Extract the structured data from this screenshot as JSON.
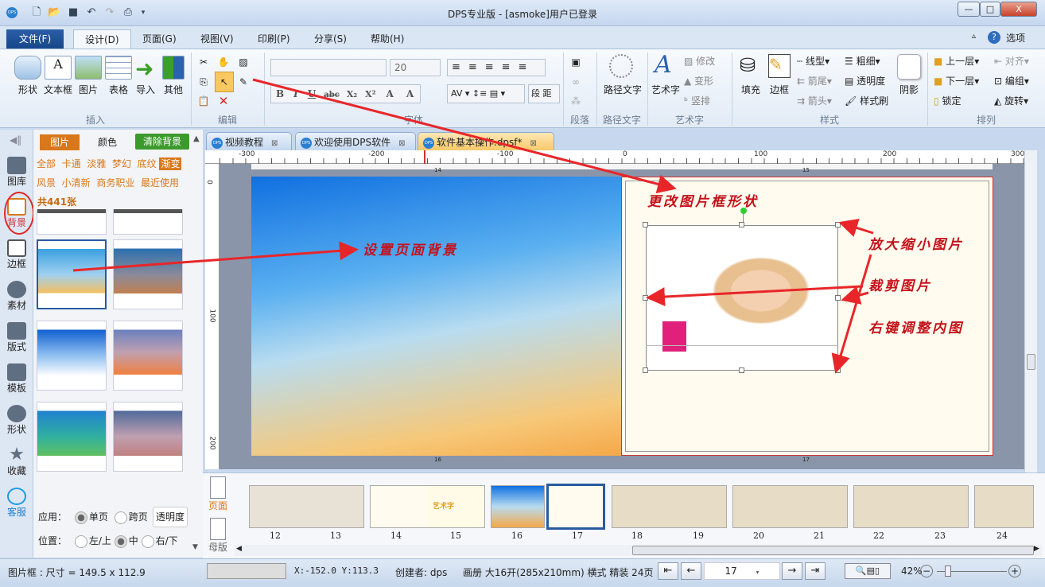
{
  "window": {
    "title": "DPS专业版 - [asmoke]用户已登录",
    "min": "—",
    "max": "□",
    "close": "X"
  },
  "menu": {
    "tabs": [
      "文件(F)",
      "设计(D)",
      "页面(G)",
      "视图(V)",
      "印刷(P)",
      "分享(S)",
      "帮助(H)"
    ],
    "active": "设计(D)",
    "options": "选项"
  },
  "ribbon": {
    "insert": {
      "label": "插入",
      "items": [
        "形状",
        "文本框",
        "图片",
        "表格",
        "导入",
        "其他"
      ]
    },
    "edit": {
      "label": "编辑"
    },
    "font": {
      "label": "字体",
      "font_name": "",
      "font_size": "20",
      "buttons": [
        "B",
        "I",
        "U",
        "abc",
        "X₂",
        "X²",
        "A",
        "A"
      ]
    },
    "paragraph": {
      "label": "段落",
      "buttons": [
        "段",
        "距"
      ]
    },
    "pathtext": {
      "label": "路径文字",
      "button": "路径文字"
    },
    "arttext": {
      "label": "艺术字",
      "button": "艺术字",
      "modify": "修改",
      "transform": "变形",
      "vertical": "竖排"
    },
    "style": {
      "label": "样式",
      "fill": "填充",
      "border": "边框",
      "linetype": "线型",
      "thickness": "粗细",
      "arrow_tail": "箭尾",
      "transparency": "透明度",
      "arrow_head": "箭头",
      "format_painter": "样式刷",
      "shadow": "阴影"
    },
    "arrange": {
      "label": "排列",
      "up": "上一层",
      "align": "对齐",
      "down": "下一层",
      "group": "编组",
      "lock": "锁定",
      "rotate": "旋转"
    }
  },
  "sidebar": {
    "items": [
      "图库",
      "背景",
      "边框",
      "素材",
      "版式",
      "模板",
      "形状",
      "收藏",
      "客服"
    ],
    "active": "背景"
  },
  "panel": {
    "tabs": [
      "图片",
      "颜色"
    ],
    "clear": "清除背景",
    "categories": [
      "全部",
      "卡通",
      "淡雅",
      "梦幻",
      "底纹",
      "渐变",
      "风景",
      "小清新",
      "商务职业",
      "最近使用"
    ],
    "active_category": "渐变",
    "count": "共441张",
    "apply_label": "应用：",
    "apply_options": [
      "单页",
      "跨页"
    ],
    "apply_selected": "单页",
    "transparency": "透明度",
    "position_label": "位置：",
    "position_options": [
      "左/上",
      "中",
      "右/下"
    ],
    "position_selected": "中"
  },
  "doc_tabs": [
    {
      "label": "视频教程"
    },
    {
      "label": "欢迎使用DPS软件"
    },
    {
      "label": "软件基本操作.dpsf*",
      "active": true
    }
  ],
  "ruler": {
    "top": [
      "-300",
      "-200",
      "-100",
      "0",
      "100",
      "200",
      "300"
    ],
    "left": [
      "0",
      "100",
      "200"
    ]
  },
  "canvas": {
    "page_numbers": [
      "14",
      "15",
      "16",
      "17"
    ],
    "annotations": {
      "bg": "设置页面背景",
      "shape": "更改图片框形状",
      "resize": "放大缩小图片",
      "crop": "裁剪图片",
      "rightclick": "右键调整内图"
    }
  },
  "thumbs": {
    "tabs": [
      "页面",
      "母版"
    ],
    "pages": [
      "12",
      "13",
      "14",
      "15",
      "16",
      "17",
      "18",
      "19",
      "20",
      "21",
      "22",
      "23",
      "24"
    ],
    "selected": "17",
    "p14_text": "艺术字"
  },
  "status": {
    "selection": "图片框 : 尺寸 = 149.5 x 112.9",
    "coords": "X:-152.0 Y:113.3",
    "creator": "创建者: dps",
    "info": "画册 大16开(285x210mm) 横式 精装 24页",
    "current_page": "17",
    "zoom": "42%"
  },
  "colors": {
    "accent": "#d9781a",
    "annotation": "#c3121b",
    "clear_btn": "#3c9a2c"
  }
}
